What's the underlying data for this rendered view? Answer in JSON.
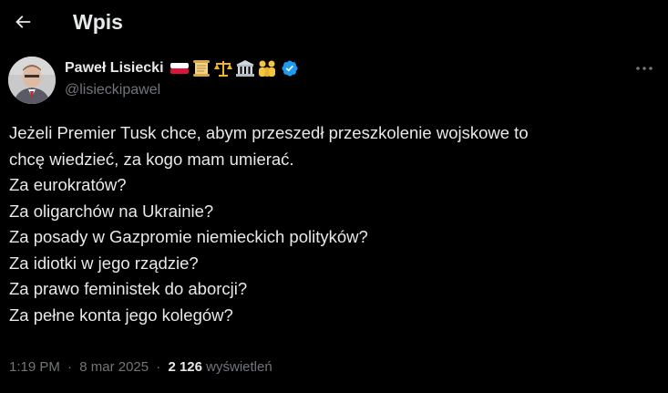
{
  "header": {
    "title": "Wpis",
    "back_icon": "arrow-left-icon"
  },
  "author": {
    "name": "Paweł Lisiecki",
    "handle": "@lisieckipawel",
    "emojis": [
      "poland-flag-emoji",
      "scroll-emoji",
      "scales-emoji",
      "classical-building-emoji",
      "family-emoji"
    ],
    "verified": true
  },
  "tweet": {
    "lines": [
      "Jeżeli Premier Tusk chce, abym przeszedł przeszkolenie wojskowe to",
      "chcę wiedzieć, za kogo mam umierać.",
      "Za eurokratów?",
      "Za oligarchów na Ukrainie?",
      "Za posady w Gazpromie niemieckich polityków?",
      "Za idiotki w jego rządzie?",
      "Za prawo feministek do aborcji?",
      "Za pełne konta jego kolegów?"
    ]
  },
  "meta": {
    "time": "1:19 PM",
    "separator": "·",
    "date": "8 mar 2025",
    "views_count": "2 126",
    "views_label": "wyświetleń"
  },
  "colors": {
    "background": "#000000",
    "text_primary": "#e7e9ea",
    "text_secondary": "#71767b",
    "verified_blue": "#1d9bf0"
  }
}
